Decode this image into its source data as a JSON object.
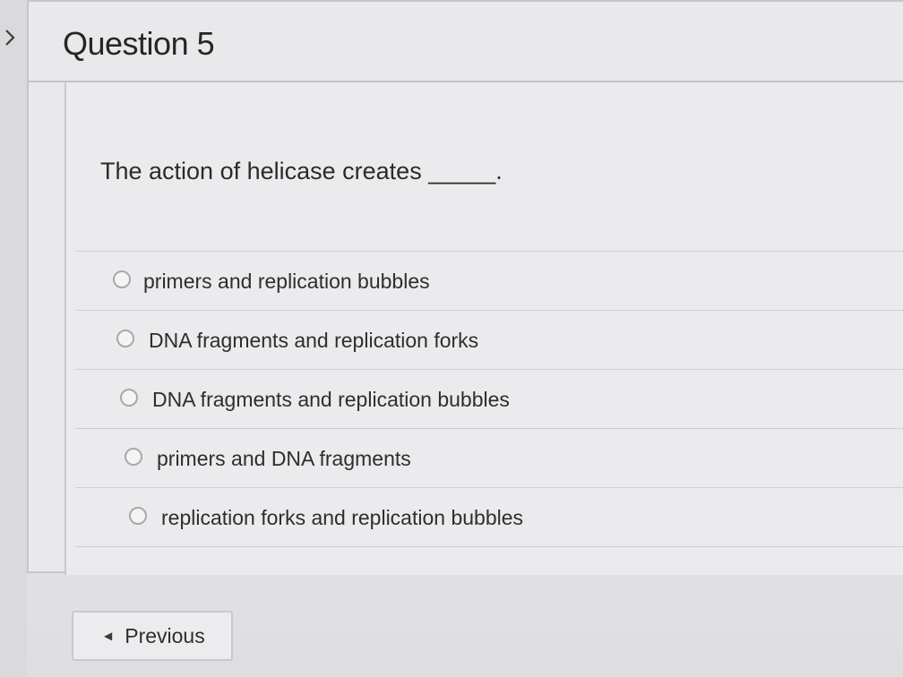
{
  "nav": {
    "toggle_icon": "chevron-right-icon"
  },
  "question": {
    "title": "Question 5",
    "text": "The action of helicase creates _____."
  },
  "answers": [
    {
      "label": "primers and replication bubbles"
    },
    {
      "label": "DNA fragments and replication forks"
    },
    {
      "label": "DNA fragments and replication bubbles"
    },
    {
      "label": "primers and DNA fragments"
    },
    {
      "label": "replication forks and replication bubbles"
    }
  ],
  "footer": {
    "previous_label": "Previous",
    "previous_icon": "caret-left-icon"
  },
  "colors": {
    "background": "#e8e8ea",
    "border": "#c6c6c8",
    "text": "#2d2d2d"
  }
}
